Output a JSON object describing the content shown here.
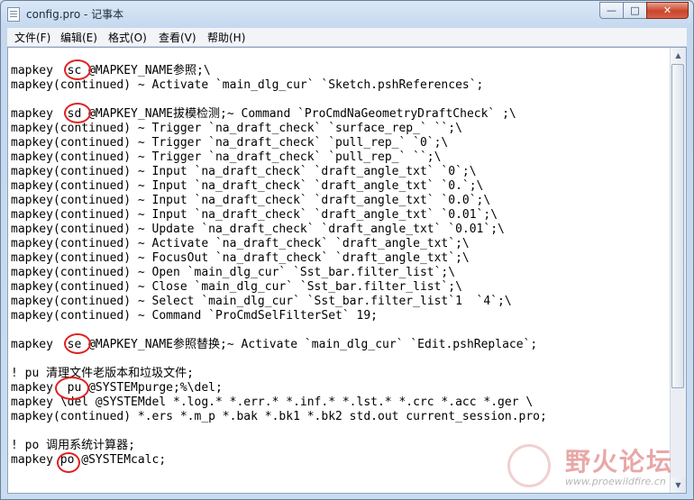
{
  "window": {
    "title": "config.pro - 记事本"
  },
  "controls": {
    "minimize": "—",
    "maximize": "□",
    "close": "✕"
  },
  "menu": [
    "文件(F)",
    "编辑(E)",
    "格式(O)",
    "查看(V)",
    "帮助(H)"
  ],
  "lines": [
    "mapkey  sc @MAPKEY_NAME参照;\\",
    "mapkey(continued) ~ Activate `main_dlg_cur` `Sketch.pshReferences`;",
    "",
    "mapkey  sd @MAPKEY_NAME拔模检测;~ Command `ProCmdNaGeometryDraftCheck` ;\\",
    "mapkey(continued) ~ Trigger `na_draft_check` `surface_rep_` ``;\\",
    "mapkey(continued) ~ Trigger `na_draft_check` `pull_rep_` `0`;\\",
    "mapkey(continued) ~ Trigger `na_draft_check` `pull_rep_` ``;\\",
    "mapkey(continued) ~ Input `na_draft_check` `draft_angle_txt` `0`;\\",
    "mapkey(continued) ~ Input `na_draft_check` `draft_angle_txt` `0.`;\\",
    "mapkey(continued) ~ Input `na_draft_check` `draft_angle_txt` `0.0`;\\",
    "mapkey(continued) ~ Input `na_draft_check` `draft_angle_txt` `0.01`;\\",
    "mapkey(continued) ~ Update `na_draft_check` `draft_angle_txt` `0.01`;\\",
    "mapkey(continued) ~ Activate `na_draft_check` `draft_angle_txt`;\\",
    "mapkey(continued) ~ FocusOut `na_draft_check` `draft_angle_txt`;\\",
    "mapkey(continued) ~ Open `main_dlg_cur` `Sst_bar.filter_list`;\\",
    "mapkey(continued) ~ Close `main_dlg_cur` `Sst_bar.filter_list`;\\",
    "mapkey(continued) ~ Select `main_dlg_cur` `Sst_bar.filter_list`1  `4`;\\",
    "mapkey(continued) ~ Command `ProCmdSelFilterSet` 19;",
    "",
    "mapkey  se @MAPKEY_NAME参照替换;~ Activate `main_dlg_cur` `Edit.pshReplace`;",
    "",
    "! pu 清理文件老版本和垃圾文件;",
    "mapkey  pu @SYSTEMpurge;%\\del;",
    "mapkey \\del @SYSTEMdel *.log.* *.err.* *.inf.* *.lst.* *.crc *.acc *.ger \\",
    "mapkey(continued) *.ers *.m_p *.bak *.bk1 *.bk2 std.out current_session.pro;",
    "",
    "! po 调用系统计算器;",
    "mapkey po @SYSTEMcalc;"
  ],
  "scrollbar": {
    "up": "▲",
    "down": "▼"
  },
  "watermark": {
    "text": "野火论坛",
    "url": "www.proewildfire.cn"
  }
}
